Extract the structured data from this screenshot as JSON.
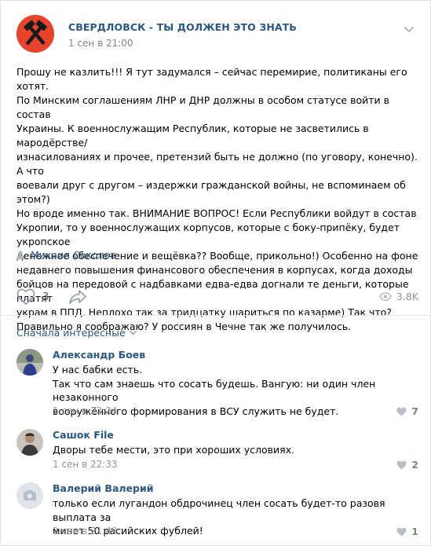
{
  "post": {
    "group_name": "СВЕРДЛОВСК - ТЫ ДОЛЖЕН ЭТО ЗНАТЬ",
    "date": "1 сен в 21:00",
    "text": "Прошу не казлить!!! Я тут задумался – сейчас перемирие, политиканы его хотят.\nПо Минским соглашениям ЛНР и ДНР должны в особом статусе войти в состав\nУкраины. К военнослужащим Республик, которые не засветились в мародёрстве/\nизнасилованиях и прочее, претензий быть не должно (по уговору, конечно). А что\nвоевали друг с другом – издержки гражданской войны, не вспоминаем об этом?)\nНо вроде именно так. ВНИМАНИЕ ВОПРОС! Если Республики войдут в состав\nУкропии, то у военнослужащих корпусов, которые с боку-припёку, будет укропское\nденежное обеспечение и вещёвка?? Вообще, прикольно!) Особенно на фоне\nнедавнего повышения финансового обеспечения в корпусах, когда доходы\nбойцов на передовой с надбавками едва-едва догнали те деньги, которые платят\nукрам в ППД. Неплохо так за тридцатку шариться по казарме) Так что?\nПравильно я соображаю? У россиян в Чечне так же получилось.",
    "signer": "Михаил Соколов",
    "likes": "3",
    "views": "3.8K",
    "colors": {
      "link": "#2a5885",
      "avatar_bg": "#e8442c"
    },
    "icons": {
      "avatar": "crossed-hammers-icon",
      "chevron": "chevron-down-icon",
      "signer": "user-icon",
      "like": "heart-icon",
      "share": "share-arrow-icon",
      "views": "eye-icon"
    }
  },
  "comments_header": {
    "sort_label": "Сначала интересные"
  },
  "comments": [
    {
      "author": "Александр Боев",
      "text": "У нас бабки есть.\nТак что сам знаешь что сосать будешь. Вангую: ни один член незаконного\nвооружённого формирования в ВСУ служить не будет.",
      "date": "1 сен в 22:24",
      "likes": "7"
    },
    {
      "author": "Сашок File",
      "text": "Дворы тебе мести, это при хороших условиях.",
      "date": "1 сен в 22:33",
      "likes": "2"
    },
    {
      "author": "Валерий Валерий",
      "text": "только если лугандон обдрочинец член сосать будет-то разовя выплата за\nминет 50 расийских фублей!",
      "date": "2 сен в 21:49",
      "likes": "1"
    }
  ]
}
